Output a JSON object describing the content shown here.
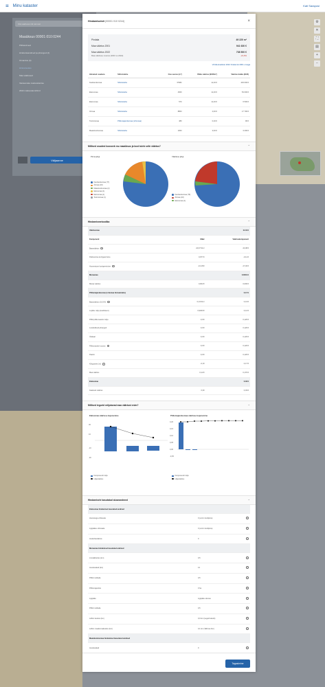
{
  "topbar": {
    "menu_label": "Minu kataster",
    "user": "Kati Saraposi"
  },
  "sidebar": {
    "search_placeholder": "Otsi aadressi või tunnust",
    "address": "Maaüksus 00001:010:0244",
    "items": [
      "Põhiandmed",
      "Hindamisandmed ja piirangud (4)",
      "Omandus (4)",
      "Hinnamuutus",
      "Maa väärtused",
      "Varasemate maksustamise",
      "2022 maksustamishind"
    ],
    "button": "Väljaanne"
  },
  "modal": {
    "title": "Hindamisotsit",
    "title_code": "(00001 010 0244)",
    "summary": {
      "area_label": "Pindala",
      "area_value": "49 220 m²",
      "value2001_label": "Maa väärtus 2001",
      "value2001_value": "941 630 €",
      "value2022_label": "Maa väärtus 2022",
      "value2022_value": "738 500 €",
      "change_label": "Maa väärtuse muutus (2001 vs 2022)",
      "change_value": "-21,6%",
      "link": "Võrdle/analüüsi 2022 hindamist 2001 omaga"
    },
    "land_table": {
      "headers": [
        "Hinnatud osadena",
        "Sihtotstarbe",
        "Osa suurus (m²)",
        "Ühiku väärtus (EUR/m²)",
        "Väärtus kokku (EUR)"
      ],
      "rows": [
        [
          "Kaubandusmaa",
          "Sihtotstarbe",
          "37982",
          "11,40 €",
          "433 000 €"
        ],
        [
          "Elamumaa",
          "Sihtotstarbe",
          "4660",
          "11,40 €",
          "53 000 €"
        ],
        [
          "Elamumaa",
          "Sihtotstarbe",
          "570",
          "11,40 €",
          "6 500 €"
        ],
        [
          "Ärimaa",
          "Sihtotstarbe",
          "8863",
          "2,00 €",
          "17 700 €"
        ],
        [
          "Tootmismaa",
          "Põllumajandusmaa (rohumaa)",
          "480",
          "0,20 €",
          "96 €"
        ],
        [
          "Maatulundusmaa",
          "Sihtotstarbe",
          "1053",
          "3,00 €",
          "3 200 €"
        ]
      ]
    },
    "pie_section": {
      "title": "Millised osadest koosneb mu maaüksus ja kust tuleb selle väärtus?",
      "left_title": "Pinna järgi",
      "right_title": "Väärtuse järgi",
      "left_legend": [
        "Kaubandusmaa (77)",
        "Ärimaa (18)",
        "Maatulundusmaa (2)",
        "Elamumaa (1)",
        "Elamumaa (1)",
        "Tootmismaa (1)"
      ],
      "right_legend": [
        "Kaubandusmaa (79)",
        "Ärimaa (18)",
        "Elamumaa (1)"
      ]
    },
    "calc_section": {
      "title": "Hindamismetoodika",
      "rows": [
        {
          "label": "Väärtusmaa",
          "a": "",
          "b": "11.34 €",
          "cls": "grey"
        },
        {
          "label": "Komponent",
          "a": "Määr",
          "b": "Väärtuskomponent",
          "cls": "hdr"
        },
        {
          "label": "Baasväärtus",
          "a": "24,67 €/m²",
          "b": "24,08 €",
          "info": true
        },
        {
          "label": "Paiknemise korrigeerimine",
          "a": "0,977 €",
          "b": "-0,11 €"
        },
        {
          "label": "Hoonestuse korrigeerimine",
          "a": "-13,18 €",
          "b": "-17,46 €",
          "info": true
        },
        {
          "label": "Metsamaa",
          "a": "",
          "b": "0.0001 €",
          "cls": "grey"
        },
        {
          "label": "Metsa väärtus",
          "a": "0,002 €",
          "b": "0,000 €"
        },
        {
          "label": "Põllumajandusmaa (rohumaa hinnaindeks)",
          "a": "",
          "b": "0.17 €",
          "cls": "grey"
        },
        {
          "label": "Baasväärtus (0,19 €)",
          "a": "0,13 €/m²",
          "b": "0,13 €",
          "info": true
        },
        {
          "label": "Lopliku mõju (koefitsient)",
          "a": "0,9300 €",
          "b": "0,12 €"
        },
        {
          "label": "PRIA põllumassiivi mõju",
          "a": "0,0 €",
          "b": "0,120 €"
        },
        {
          "label": "Looduslikud piirangud",
          "a": "0,0 €",
          "b": "0,120 €"
        },
        {
          "label": "Ülekaal",
          "a": "0,0 €",
          "b": "0,120 €"
        },
        {
          "label": "Põllumassiivi suurus",
          "a": "0,0 €",
          "b": "0,120 €",
          "info": true
        },
        {
          "label": "Paekiv",
          "a": "0,0 €",
          "b": "0,120 €"
        },
        {
          "label": "Kõrgustest (m)",
          "a": "-0,10",
          "b": "0,17 €",
          "info": true
        },
        {
          "label": "Maa väärtus",
          "a": "0,12 €",
          "b": "0,170 €"
        },
        {
          "label": "Elatusmaa",
          "a": "",
          "b": "0.03 €",
          "cls": "grey"
        },
        {
          "label": "Kaalutud väärtus",
          "a": "0,00",
          "b": "0,03 €"
        }
      ]
    },
    "bar_section": {
      "title": "Millised tegurid mõjutavad maa väärtust enim?",
      "left_title": "Elatusmaa väärtuse kujunemine",
      "right_title": "Põllumajandusmaa väärtuse kujunemine",
      "left_legend": [
        "Komponendi mõju",
        "Lõppväärtus"
      ],
      "right_legend": [
        "Komponendi mõju",
        "Lõppväärtus"
      ],
      "left_ticks": [
        "30",
        "10",
        "-10",
        "-30"
      ],
      "right_ticks": [
        "0,20",
        "0,15",
        "0,10",
        "0,05",
        "0,00",
        "-0,05"
      ]
    },
    "param_section": {
      "title": "Hindamisele kasutatud aluseandmed",
      "groups": [
        {
          "title": "Elatusmaa hindamisel kasutatud andmed",
          "rows": [
            [
              "Hoonetega ehitusala",
              "0 (vormi tooltipina)"
            ],
            [
              "Ligipääsu ehitusala",
              "0 (vormi tooltipina)"
            ],
            [
              "Asukohaväärtus",
              "0"
            ]
          ]
        },
        {
          "title": "Metsamaa hindamisel kasutatud andmed",
          "rows": [
            [
              "Linnalähedus (km)",
              "0,5"
            ],
            [
              "Asustusalad (km)",
              "13"
            ],
            [
              "PRIA muldade",
              "0,5"
            ],
            [
              "Põllumajandus",
              "0 ha"
            ],
            [
              "Ligipääs",
              "Ligipääs olemas"
            ],
            [
              "PRIA muldade",
              "0,5"
            ],
            [
              "Lähim keskus (km)",
              "0,0 km (Lagedi alevik)"
            ],
            [
              "Lähim maakonnakeskus (km)",
              "0,1 km (Tallinna linn)"
            ]
          ]
        },
        {
          "title": "Maatulundusmaa hindamisel kasutatud andmed",
          "rows": [
            [
              "Asustusalad",
              "0"
            ]
          ]
        },
        {
          "title": "Metsamaa hindamisel kasutatud andmed",
          "rows": []
        }
      ],
      "footnote": "Maa hindamisel on kasutatud hindamisprojektis kirjeldatud andmeid ja hinnatavat maaüksust kirjeldavaid andmeid"
    },
    "close_label": "Tagasimine"
  },
  "colors": {
    "accent": "#2563a8",
    "pie_blue": "#3a6fb5",
    "pie_orange": "#e8882b",
    "pie_red": "#c0392b",
    "pie_green": "#6aa84f",
    "pie_yellow": "#e6c14a",
    "pie_grey": "#9aa0a6"
  }
}
